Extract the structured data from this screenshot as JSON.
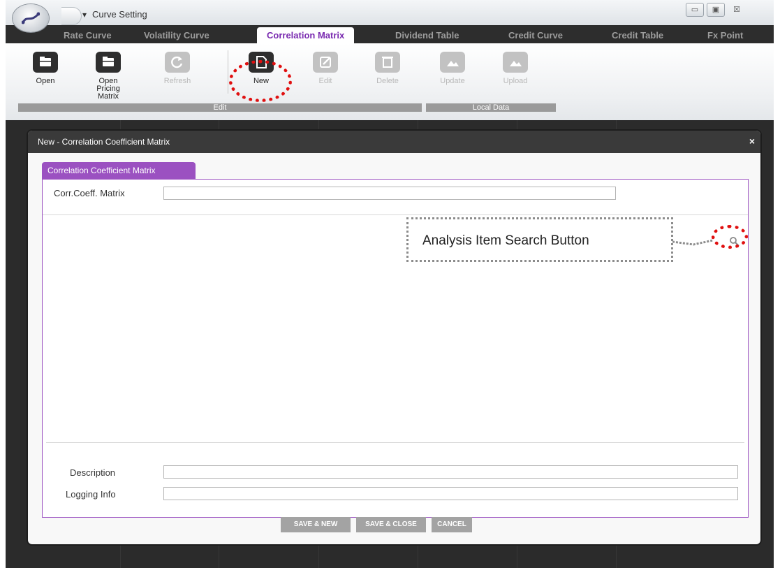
{
  "titlebar": {
    "title": "Curve Setting",
    "qa_menu": "▾",
    "minimize": "▭",
    "maximize": "▣",
    "close": "☒"
  },
  "tabs": [
    {
      "label": "Rate Curve",
      "active": false
    },
    {
      "label": "Volatility Curve",
      "active": false
    },
    {
      "label": "Correlation Matrix",
      "active": true
    },
    {
      "label": "Dividend Table",
      "active": false
    },
    {
      "label": "Credit Curve",
      "active": false
    },
    {
      "label": "Credit Table",
      "active": false
    },
    {
      "label": "Fx Point",
      "active": false
    }
  ],
  "ribbon": {
    "open": "Open",
    "open_pricing": "Open Pricing Matrix",
    "refresh": "Refresh",
    "new": "New",
    "edit": "Edit",
    "delete": "Delete",
    "update": "Update",
    "upload": "Upload",
    "group_edit": "Edit",
    "group_local": "Local Data"
  },
  "dialog": {
    "title": "New - Correlation Coefficient Matrix",
    "close": "×",
    "panel_tab": "Correlation Coefficient Matrix",
    "corr_label": "Corr.Coeff. Matrix",
    "corr_value": "",
    "description_label": "Description",
    "description_value": "",
    "logging_label": "Logging Info",
    "logging_value": "",
    "save_new": "SAVE & NEW",
    "save_close": "SAVE & CLOSE",
    "cancel": "CANCEL"
  },
  "annotation": {
    "callout": "Analysis Item Search Button",
    "color": "#e01010"
  }
}
